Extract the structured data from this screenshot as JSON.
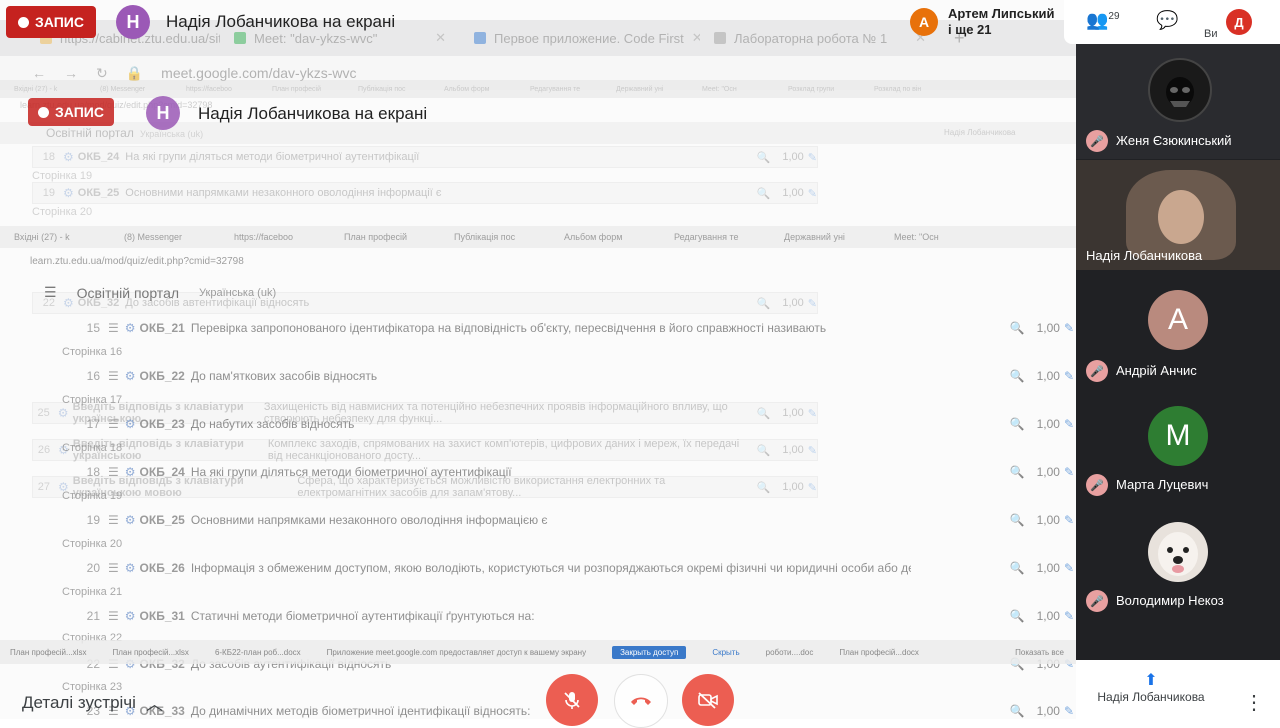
{
  "meet": {
    "recording_label": "ЗАПИС",
    "presenter_initial": "Н",
    "presenter_banner": "Надія Лобанчикова на екрані",
    "top_participant_initial": "А",
    "top_participant_name": "Артем Липський",
    "top_participant_more": "і ще 21",
    "participants_count": "29",
    "self_initial": "Д",
    "self_label": "Ви",
    "meeting_details_label": "Деталі зустрічі",
    "presenting_label": "Надія Лобанчикова"
  },
  "browser_outer": {
    "tabs": [
      {
        "label": "https://cabinet.ztu.edu.ua/site/sc"
      },
      {
        "label": "Meet: \"dav-ykzs-wvc\""
      },
      {
        "label": "Первое приложение. Code First"
      },
      {
        "label": "Лабораторна робота № 1"
      }
    ],
    "url": "meet.google.com/dav-ykzs-wvc"
  },
  "browser_inner": {
    "tabs": [
      {
        "label": "Вхідні (27) - k"
      },
      {
        "label": "(8) Messenger"
      },
      {
        "label": "https://faceboo"
      },
      {
        "label": "План професій"
      },
      {
        "label": "Публікація пос"
      },
      {
        "label": "Альбом форм"
      },
      {
        "label": "Редагування те"
      },
      {
        "label": "Державний уні"
      },
      {
        "label": "Meet: \"Осн"
      },
      {
        "label": "Розклад групи"
      },
      {
        "label": "Розклад по він"
      }
    ],
    "url": "learn.ztu.edu.ua/mod/quiz/edit.php?cmid=32798",
    "portal_title": "Освітній портал",
    "language": "Українська (uk)",
    "user": "Надія Лобанчикова"
  },
  "quiz": {
    "mark": "1,00",
    "sections": [
      {
        "page": "Сторінка 16",
        "num": "15",
        "code": "ОКБ_21",
        "text": "Перевірка запропонованого ідентифікатора на відповідність об'єкту, пересвідчення в його справжності називають"
      },
      {
        "page": "Сторінка 17",
        "num": "16",
        "code": "ОКБ_22",
        "text": "До пам'яткових засобів відносять"
      },
      {
        "page": "Сторінка 18",
        "num": "17",
        "code": "ОКБ_23",
        "text": "До набутих засобів відносять"
      },
      {
        "page": "Сторінка 19",
        "num": "18",
        "code": "ОКБ_24",
        "text": "На які групи діляться методи біометричної аутентифікації"
      },
      {
        "page": "Сторінка 20",
        "num": "19",
        "code": "ОКБ_25",
        "text": "Основними напрямками незаконного оволодіння інформацією є"
      },
      {
        "page": "Сторінка 21",
        "num": "20",
        "code": "ОКБ_26",
        "text": "Інформація з обмеженим доступом, якою володіють, користуються чи розпоряджаються окремі фізичні чи юридичні особи або держава і порядок доступу до я..."
      },
      {
        "page": "Сторінка 22",
        "num": "21",
        "code": "ОКБ_31",
        "text": "Статичні методи біометричної аутентифікації ґрунтуються на:"
      },
      {
        "page": "Сторінка 23",
        "num": "22",
        "code": "ОКБ_32",
        "text": "До засобів аутентифікації відносять"
      },
      {
        "page": "",
        "num": "23",
        "code": "ОКБ_33",
        "text": "До динамічних методів біометричної ідентифікації відносять:"
      }
    ],
    "inner_rows": [
      {
        "num": "18",
        "code": "ОКБ_24",
        "text": "На які групи діляться методи біометричної аутентифікації"
      },
      {
        "num": "19",
        "code": "ОКБ_25",
        "text": "Основними напрямками незаконного оволодіння інформації є"
      },
      {
        "num": "22",
        "code": "ОКБ_32",
        "text": "До засобів автентифікації відносять"
      },
      {
        "num": "23",
        "code": "ОКБ_33",
        "text": "До динамічних методів біометричної ідентифікації відносять:"
      },
      {
        "num": "25",
        "code": "Введіть відповідь з клавіатури українською",
        "text": "Захищеність від навмисних та потенційно небезпечних проявів інформаційного впливу, що створюють небезпеку для функці..."
      },
      {
        "num": "26",
        "code": "Введіть відповідь з клавіатури українською",
        "text": "Комплекс заходів, спрямованих на захист комп'ютерів, цифрових даних і мереж, їх передачі від несанкціонованого досту..."
      },
      {
        "num": "27",
        "code": "Введіть відповідь з клавіатури українською мовою",
        "text": "Сфера, що характеризується можливістю використання електронних та електромагнітних засобів для запам'ятову..."
      }
    ]
  },
  "dock": {
    "items": [
      "План професій...xlsx",
      "План професій...xlsx",
      "6-КБ22-план роб...docx",
      "Приложение meet.google.com предоставляет доступ к вашему экрану",
      "Закрыть доступ",
      "Скрыть",
      "роботи....doc",
      "План професій...docx",
      "Показать все"
    ]
  },
  "participants": [
    {
      "name": "Женя Єзюкинський",
      "kind": "photo"
    },
    {
      "name": "Надія Лобанчикова",
      "kind": "camera"
    },
    {
      "name": "Андрій Анчис",
      "initial": "А",
      "color": "#b98a7e"
    },
    {
      "name": "Марта Луцевич",
      "initial": "М",
      "color": "#2e7d32"
    },
    {
      "name": "Володимир Некоз",
      "kind": "dog"
    }
  ]
}
